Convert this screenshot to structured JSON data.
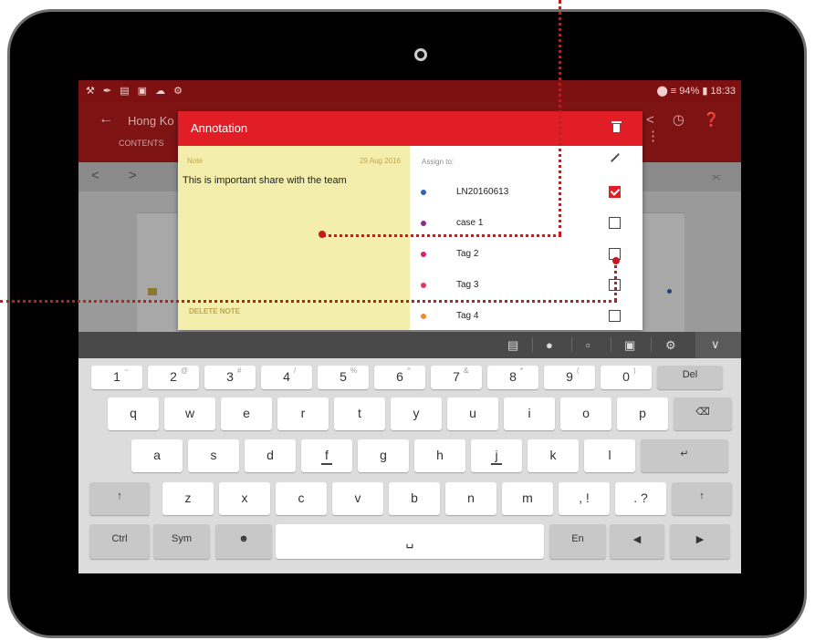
{
  "status_bar": {
    "left_icons": "⚒ ✒ ▤ ▣ ☁ ⚙",
    "right": "⬤ ≡ 94% ▮ 18:33"
  },
  "app_bar": {
    "title": "Hong Ko",
    "tab": "CONTENTS",
    "actions": "< ◷ ❓ ⋮"
  },
  "doc_toolbar": {
    "prev_next": "< >",
    "collapse": "⫘"
  },
  "dialog": {
    "title": "Annotation",
    "note_label": "Note",
    "note_date": "29 Aug 2016",
    "note_text": "This is important share with the team",
    "delete_label": "DELETE NOTE",
    "assign_label": "Assign to:",
    "tags": [
      {
        "label": "LN20160613",
        "color": "#2f64b6",
        "checked": true
      },
      {
        "label": "case 1",
        "color": "#8a2c8e",
        "checked": false
      },
      {
        "label": "Tag 2",
        "color": "#d8246e",
        "checked": false
      },
      {
        "label": "Tag 3",
        "color": "#de3a5a",
        "checked": false
      },
      {
        "label": "Tag 4",
        "color": "#f08c2c",
        "checked": false
      }
    ]
  },
  "keyboard": {
    "row1": [
      {
        "label": "1",
        "sup": "~"
      },
      {
        "label": "2",
        "sup": "@"
      },
      {
        "label": "3",
        "sup": "#"
      },
      {
        "label": "4",
        "sup": "/"
      },
      {
        "label": "5",
        "sup": "%"
      },
      {
        "label": "6",
        "sup": "^"
      },
      {
        "label": "7",
        "sup": "&"
      },
      {
        "label": "8",
        "sup": "*"
      },
      {
        "label": "9",
        "sup": "("
      },
      {
        "label": "0",
        "sup": ")"
      },
      {
        "label": "Del",
        "sup": ""
      }
    ],
    "row2": [
      "q",
      "w",
      "e",
      "r",
      "t",
      "y",
      "u",
      "i",
      "o",
      "p",
      "⌫"
    ],
    "row3": [
      "a",
      "s",
      "d",
      "f",
      "g",
      "h",
      "j",
      "k",
      "l",
      "↵"
    ],
    "row4": [
      "↑",
      "z",
      "x",
      "c",
      "v",
      "b",
      "n",
      "m",
      ", !",
      ". ?",
      "↑"
    ],
    "row5": [
      "Ctrl",
      "Sym",
      "☻",
      "␣",
      "En",
      "◀",
      "▶"
    ]
  },
  "colors": {
    "accent": "#e11d26",
    "note_bg": "#f3eeac",
    "annotation_line": "#c8191f"
  }
}
